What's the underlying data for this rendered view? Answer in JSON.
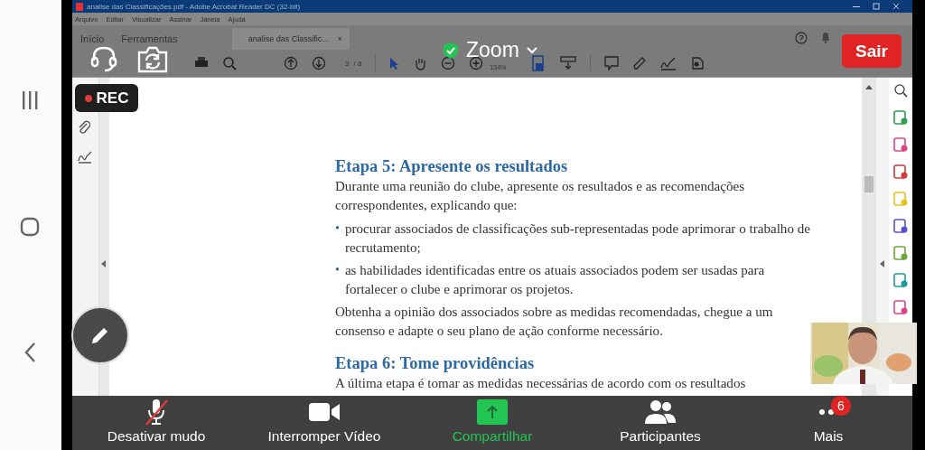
{
  "acrobat": {
    "title": "analise das Classificações.pdf - Adobe Acrobat Reader DC (32-bit)",
    "menu": [
      "Arquivo",
      "Editar",
      "Visualizar",
      "Assinar",
      "Janela",
      "Ajuda"
    ],
    "tabs": [
      {
        "label": "Início",
        "selected": false
      },
      {
        "label": "Ferramentas",
        "selected": false
      },
      {
        "label": "analise das Classific...",
        "selected": true
      }
    ],
    "tab_close": "×",
    "page_number": "3",
    "page_total": "/ 8",
    "zoom_level": "134%"
  },
  "meeting": {
    "title": "Zoom",
    "recording": "REC",
    "leave_button": "Sair"
  },
  "document": {
    "sections": [
      {
        "heading": "Etapa 5: Apresente os resultados",
        "blocks": [
          {
            "kind": "paragraph",
            "text": "Durante uma reunião do clube, apresente os resultados e as recomendações correspondentes, explicando que:"
          },
          {
            "kind": "bullet",
            "marker": "•",
            "text": "procurar associados de classificações sub-representadas pode aprimorar o trabalho de recrutamento;"
          },
          {
            "kind": "bullet",
            "marker": "•",
            "text": "as habilidades identificadas entre os atuais associados podem ser usadas para fortalecer o clube e aprimorar os projetos."
          },
          {
            "kind": "paragraph",
            "text": "Obtenha a opinião dos associados sobre as medidas recomendadas, chegue a um consenso e adapte o seu plano de ação conforme necessário."
          }
        ]
      },
      {
        "heading": "Etapa 6: Tome providências",
        "blocks": [
          {
            "kind": "paragraph",
            "text": "A última etapa é tomar as medidas necessárias de acordo com os resultados"
          }
        ]
      }
    ]
  },
  "controls": [
    {
      "kind": "mic_muted",
      "label": "Desativar mudo"
    },
    {
      "kind": "video",
      "label": "Interromper Vídeo"
    },
    {
      "kind": "share",
      "label": "Compartilhar"
    },
    {
      "kind": "participants",
      "label": "Participantes"
    },
    {
      "kind": "more",
      "label": "Mais",
      "badge": "6"
    }
  ]
}
